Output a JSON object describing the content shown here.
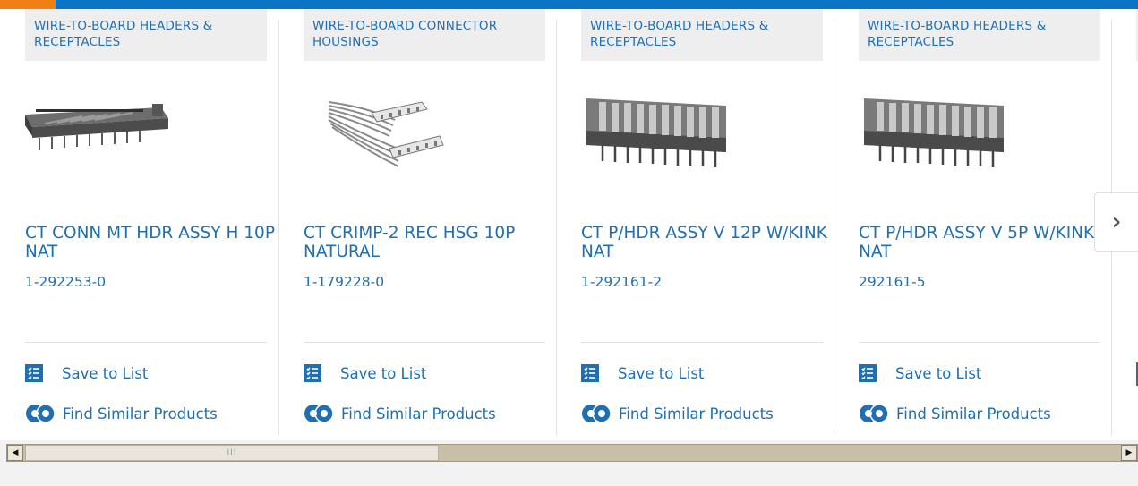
{
  "products": [
    {
      "category": "WIRE-TO-BOARD HEADERS & RECEPTACLES",
      "title": "CT CONN MT HDR ASSY H 10P NAT",
      "part_number": "1-292253-0",
      "image_icon": "horizontal-header-image",
      "save_label": "Save to List",
      "similar_label": "Find Similar Products"
    },
    {
      "category": "WIRE-TO-BOARD CONNECTOR HOUSINGS",
      "title": "CT CRIMP-2 REC HSG 10P NATURAL",
      "part_number": "1-179228-0",
      "image_icon": "ribbon-cable-image",
      "save_label": "Save to List",
      "similar_label": "Find Similar Products"
    },
    {
      "category": "WIRE-TO-BOARD HEADERS & RECEPTACLES",
      "title": "CT P/HDR ASSY V 12P W/KINK NAT",
      "part_number": "1-292161-2",
      "image_icon": "vertical-header-image",
      "save_label": "Save to List",
      "similar_label": "Find Similar Products"
    },
    {
      "category": "WIRE-TO-BOARD HEADERS & RECEPTACLES",
      "title": "CT P/HDR ASSY V 5P W/KINK NAT",
      "part_number": "292161-5",
      "image_icon": "vertical-header-image",
      "save_label": "Save to List",
      "similar_label": "Find Similar Products"
    }
  ],
  "carousel": {
    "next_icon": "chevron-right-icon",
    "next_glyph": "›"
  },
  "scrollbar": {
    "left_arrow_glyph": "◀",
    "right_arrow_glyph": "▶",
    "thumb_grip": "III",
    "position": 0
  },
  "colors": {
    "accent_blue": "#1f6fb2",
    "top_bar_blue": "#0b74c4",
    "top_bar_orange": "#f07f16"
  }
}
